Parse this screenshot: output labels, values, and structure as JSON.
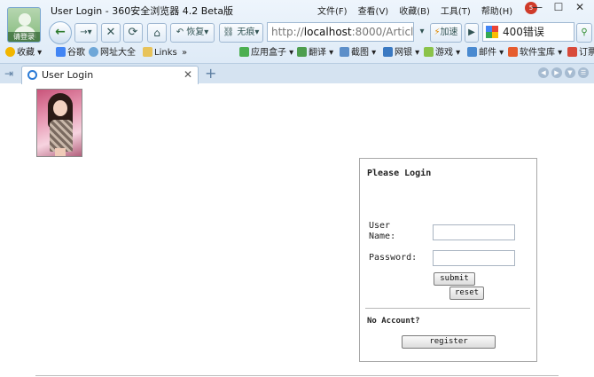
{
  "window": {
    "title": "User Login - 360安全浏览器 4.2 Beta版",
    "avatar_label": "请登录",
    "menu": [
      "文件(F)",
      "查看(V)",
      "收藏(B)",
      "工具(T)",
      "帮助(H)"
    ],
    "notification_count": "5",
    "controls": {
      "minimize": "—",
      "maximize": "☐",
      "close": "✕"
    }
  },
  "toolbar": {
    "restore_label": "恢复",
    "incognito_label": "无痕",
    "address_prefix": "http://",
    "address_host": "localhost",
    "address_rest": ":8000/Articl",
    "accelerate_label": "加速",
    "search_value": "400错误"
  },
  "bookmarks": {
    "items": [
      "收藏",
      "谷歌",
      "网址大全",
      "Links",
      "»"
    ],
    "right_items": [
      "应用盒子",
      "翻译",
      "截图",
      "网银",
      "游戏",
      "邮件",
      "软件宝库",
      "订票"
    ]
  },
  "tabs": [
    {
      "label": "User Login"
    }
  ],
  "login": {
    "title": "Please Login",
    "username_label": "User Name:",
    "username_value": "",
    "password_label": "Password:",
    "password_value": "",
    "submit_label": "submit",
    "reset_label": "reset",
    "no_account_label": "No Account?",
    "register_label": "register"
  },
  "colors": {
    "accent": "#2b7bd6",
    "chrome_bg": "#dde9f6",
    "border": "#a8a8a8"
  }
}
